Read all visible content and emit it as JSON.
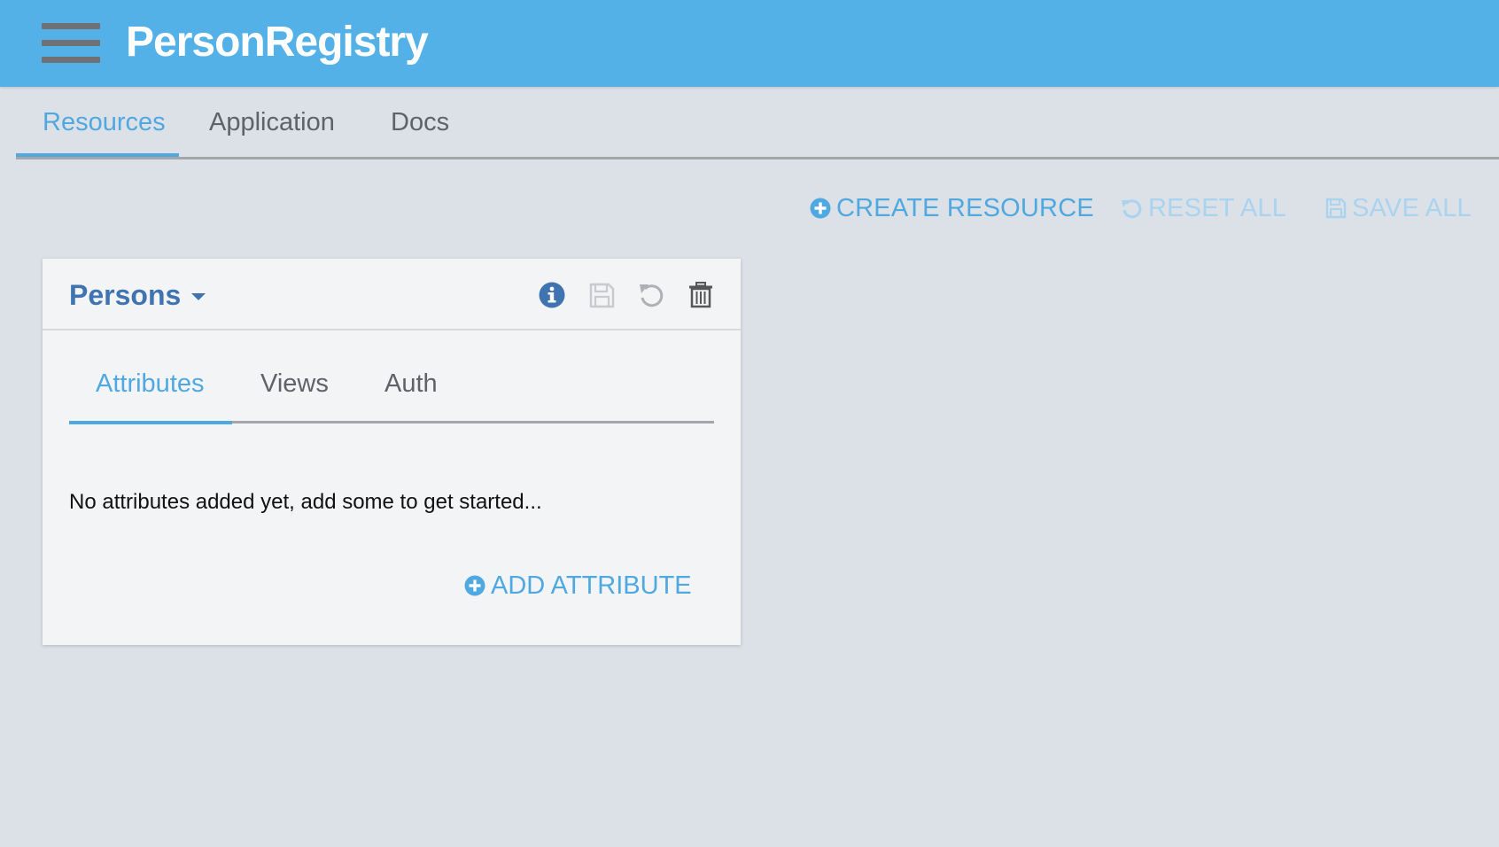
{
  "app": {
    "title": "PersonRegistry",
    "accent_color": "#54b1e7",
    "menu_icon": "hamburger-menu-icon"
  },
  "nav_tabs": [
    {
      "label": "Resources",
      "active": true
    },
    {
      "label": "Application",
      "active": false
    },
    {
      "label": "Docs",
      "active": false
    }
  ],
  "toolbar": {
    "create_label": "CREATE RESOURCE",
    "reset_label": "RESET ALL",
    "save_label": "SAVE ALL",
    "create_icon": "plus-circle-icon",
    "reset_icon": "undo-icon",
    "save_icon": "floppy-disk-icon"
  },
  "resource_card": {
    "name": "Persons",
    "header_icons": [
      "info-icon",
      "save-icon",
      "undo-icon",
      "trash-icon"
    ],
    "tabs": [
      {
        "label": "Attributes",
        "active": true
      },
      {
        "label": "Views",
        "active": false
      },
      {
        "label": "Auth",
        "active": false
      }
    ],
    "empty_message": "No attributes added yet, add some to get started...",
    "add_attribute_label": "ADD ATTRIBUTE"
  }
}
